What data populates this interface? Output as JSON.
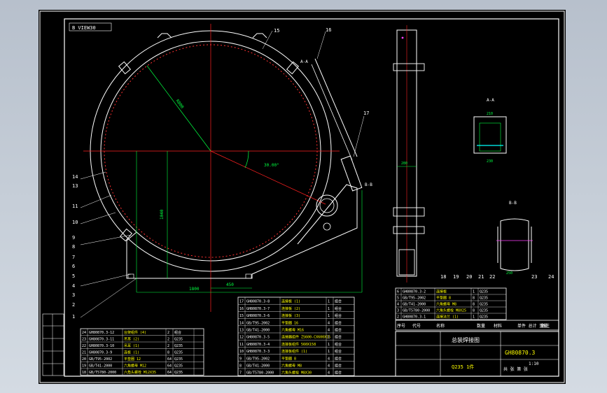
{
  "drawing": {
    "view_label": "B VIEW30",
    "balloons": [
      "15",
      "16",
      "17",
      "14",
      "13",
      "11",
      "10",
      "9",
      "8",
      "7",
      "6",
      "5",
      "4",
      "3",
      "2",
      "1",
      "18",
      "19",
      "20",
      "21",
      "22",
      "23",
      "24"
    ],
    "dims": {
      "radius": "R800",
      "angle": "30.00°",
      "height_left": "1040",
      "bottom_total": "1800",
      "bottom_mid": "450",
      "side_height": "280",
      "section_width_top": "210",
      "section_width_bottom": "230",
      "detail_width": "250"
    },
    "sections": {
      "a": "A-A",
      "b": "B-B",
      "c": "C"
    }
  },
  "bom_left": {
    "rows": [
      [
        "24",
        "GH80870.3-12",
        "台架组件 (4)",
        "2",
        "组合",
        ""
      ],
      [
        "23",
        "GH80870.3-11",
        "吊耳 (2)",
        "2",
        "Q235",
        ""
      ],
      [
        "22",
        "GH80870.3-10",
        "吊耳 (1)",
        "2",
        "Q235",
        ""
      ],
      [
        "21",
        "GH80870.3-9",
        "连板 (1)",
        "8",
        "Q235",
        ""
      ],
      [
        "20",
        "GB/T95-2002",
        "平垫圈  12",
        "64",
        "Q235",
        ""
      ],
      [
        "19",
        "GB/T41-2000",
        "六角螺母  M12",
        "64",
        "Q235",
        ""
      ],
      [
        "18",
        "GB/T5780-2000",
        "六角头螺栓 M12X35",
        "64",
        "Q235",
        ""
      ]
    ]
  },
  "bom_mid": {
    "rows": [
      [
        "17",
        "GH80870.3-8",
        "连接板 (1)",
        "1",
        "组合"
      ],
      [
        "16",
        "GH80870.3-7",
        "连接板 (2)",
        "1",
        "组合"
      ],
      [
        "15",
        "GH80870.3-6",
        "连接板 (3)",
        "1",
        "组合"
      ],
      [
        "14",
        "GB/T95-2002",
        "平垫圈  16",
        "4",
        "组合"
      ],
      [
        "13",
        "GB/T41-2000",
        "六角螺母  M16",
        "4",
        "组合"
      ],
      [
        "12",
        "GH80870.3-5",
        "连接器组件 ZS600-CX600X15",
        "1",
        "组合"
      ],
      [
        "11",
        "GH80870.3-4",
        "连接板组件 560X158",
        "1",
        "组合"
      ],
      [
        "10",
        "GH80870.3-3",
        "连接板组件 (1)",
        "1",
        "组合"
      ],
      [
        "9",
        "GB/T95-2002",
        "平垫圈  8",
        "4",
        "组合"
      ],
      [
        "8",
        "GB/T41-2000",
        "六角螺母  M8",
        "4",
        "组合"
      ],
      [
        "7",
        "GB/T5780-2000",
        "六角头螺栓 M8X30",
        "4",
        "组合"
      ]
    ]
  },
  "bom_right": {
    "rows": [
      [
        "6",
        "GH80870.3-2",
        "连接板",
        "1",
        "Q235"
      ],
      [
        "5",
        "GB/T95-2002",
        "平垫圈  8",
        "8",
        "Q235"
      ],
      [
        "4",
        "GB/T41-2000",
        "六角螺母  M8",
        "8",
        "Q235"
      ],
      [
        "3",
        "GB/T5780-2000",
        "六角头螺栓 M8X25",
        "8",
        "Q235"
      ],
      [
        "2",
        "GH80870.3-1",
        "连接法兰 (1)",
        "1",
        "Q235"
      ]
    ],
    "header": [
      "序号",
      "代号",
      "名称",
      "数量",
      "材料",
      "单件 总计 重量",
      "备注"
    ]
  },
  "title_block": {
    "name": "总装焊接图",
    "drawing_no": "GH80870.3",
    "material": "Q235  1件",
    "scale": "1:10",
    "sheet": "共 张 第 张"
  },
  "colors": {
    "paper": "#000000",
    "line": "#ffffff",
    "center": "#ff2020",
    "dim": "#00ff40",
    "accent": "#ffff00",
    "cyan": "#00ffff",
    "magenta": "#ff40ff"
  }
}
